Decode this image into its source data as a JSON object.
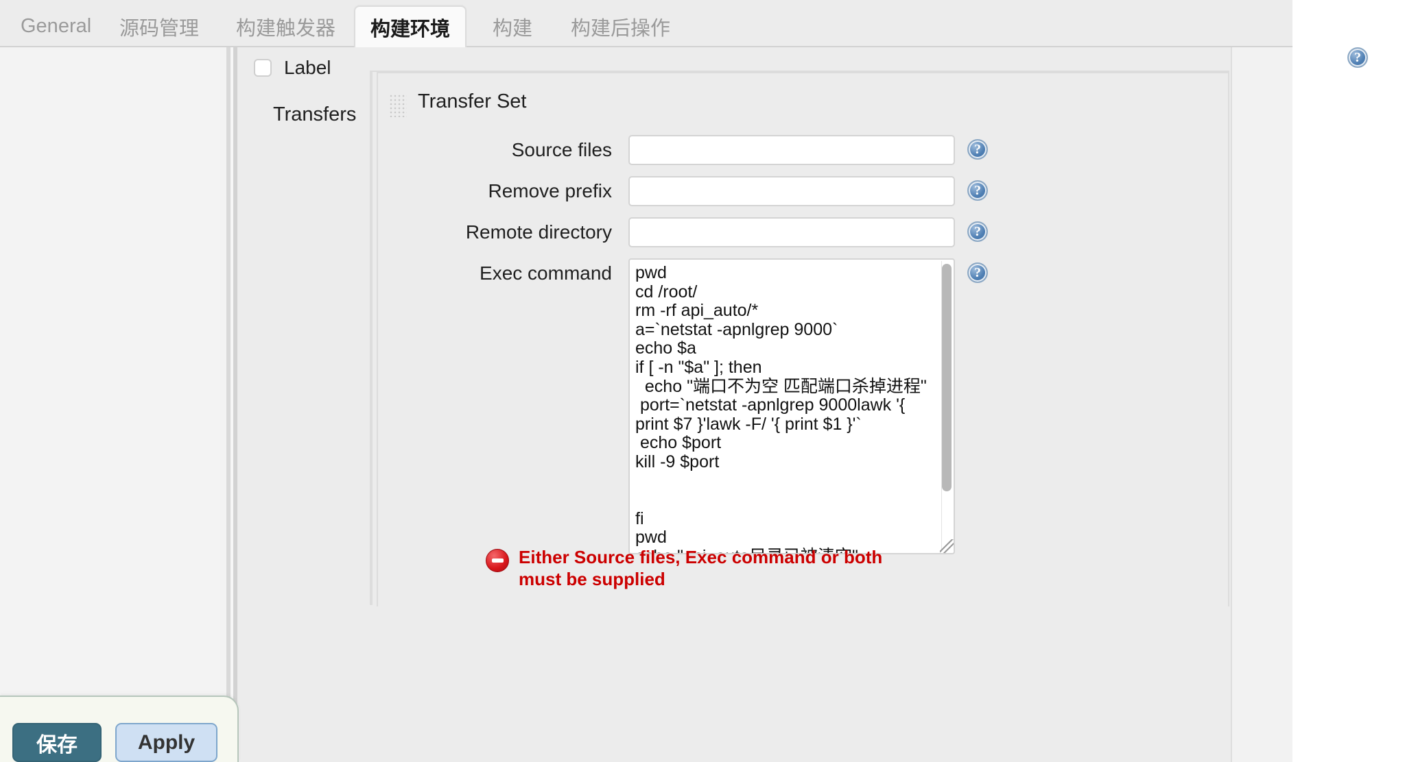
{
  "tabs": [
    {
      "label": "General",
      "active": false
    },
    {
      "label": "源码管理",
      "active": false
    },
    {
      "label": "构建触发器",
      "active": false
    },
    {
      "label": "构建环境",
      "active": true
    },
    {
      "label": "构建",
      "active": false
    },
    {
      "label": "构建后操作",
      "active": false
    }
  ],
  "form": {
    "label_checkbox_label": "Label",
    "label_checkbox_checked": false,
    "transfers_label": "Transfers",
    "transfer_set_title": "Transfer Set",
    "help_icon": "help-icon",
    "grip_icon": "drag-handle-icon",
    "rows": {
      "source_files": {
        "label": "Source files",
        "value": "",
        "placeholder": ""
      },
      "remove_prefix": {
        "label": "Remove prefix",
        "value": "",
        "placeholder": ""
      },
      "remote_directory": {
        "label": "Remote directory",
        "value": "",
        "placeholder": ""
      },
      "exec_command": {
        "label": "Exec command",
        "value": "pwd\ncd /root/\nrm -rf api_auto/*\na=`netstat -apnlgrep 9000`\necho $a\nif [ -n \"$a\" ]; then\n  echo \"端口不为空 匹配端口杀掉进程\"\n port=`netstat -apnlgrep 9000lawk '{ print $7 }'lawk -F/ '{ print $1 }'`\n echo $port\nkill -9 $port\n\n\nfi\npwd\necho \"api_auto目录已被清空\"",
        "placeholder": ""
      }
    }
  },
  "error": {
    "icon": "error-circle-icon",
    "text": "Either Source files, Exec command or both must be supplied",
    "color": "#cc0000"
  },
  "savebar": {
    "save_label": "保存",
    "apply_label": "Apply",
    "save_color": "#3c6f82",
    "apply_color": "#cfe0f3"
  }
}
